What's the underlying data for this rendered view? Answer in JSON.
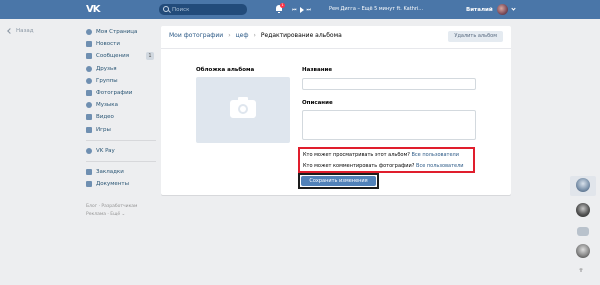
{
  "header": {
    "search_placeholder": "Поиск",
    "notifications_badge": "1",
    "now_playing": "Рем Дигга – Ещё 5 минут ft. Kathri...",
    "user_name": "Виталий",
    "colors": {
      "bar": "#4a76a8",
      "badge": "#ff3347"
    }
  },
  "back_label": "Назад",
  "sidebar": {
    "items": [
      {
        "label": "Моя Страница",
        "icon": "home-icon"
      },
      {
        "label": "Новости",
        "icon": "news-icon"
      },
      {
        "label": "Сообщения",
        "icon": "chat-icon",
        "count": "1"
      },
      {
        "label": "Друзья",
        "icon": "friends-icon"
      },
      {
        "label": "Группы",
        "icon": "groups-icon"
      },
      {
        "label": "Фотографии",
        "icon": "photo-icon"
      },
      {
        "label": "Музыка",
        "icon": "music-icon"
      },
      {
        "label": "Видео",
        "icon": "video-icon"
      },
      {
        "label": "Игры",
        "icon": "games-icon"
      }
    ],
    "pay": {
      "label": "VK Pay",
      "icon": "vkpay-icon"
    },
    "extra": [
      {
        "label": "Закладки",
        "icon": "bookmarks-icon"
      },
      {
        "label": "Документы",
        "icon": "documents-icon"
      }
    ],
    "footer": [
      "Блог · Разработчикам",
      "Реклама · Ещё ⌄"
    ]
  },
  "breadcrumbs": {
    "my_photos": "Мои фотографии",
    "album": "цеф",
    "current": "Редактирование альбома"
  },
  "delete_button": "Удалить альбом",
  "form": {
    "cover_label": "Обложка альбома",
    "name_label": "Название",
    "name_value": "",
    "description_label": "Описание",
    "description_value": "",
    "view_question": "Кто может просматривать этот альбом?",
    "view_value": "Все пользователи",
    "comment_question": "Кто может комментировать фотографии?",
    "comment_value": "Все пользователи",
    "save_button": "Сохранить изменения",
    "highlight_color": "#e01e2d"
  },
  "rail": {
    "up_label": "⇈"
  }
}
